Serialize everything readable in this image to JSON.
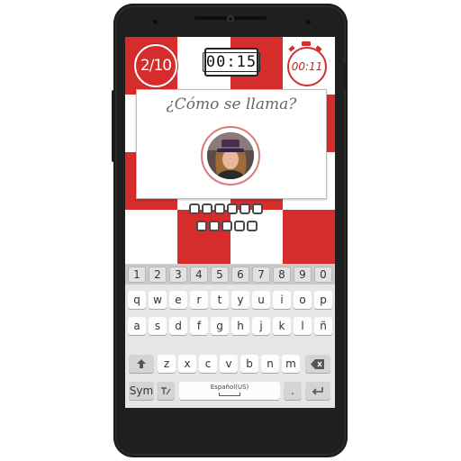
{
  "hud": {
    "score": "2/10",
    "timer": "00:15",
    "stopwatch": "00:11"
  },
  "question": {
    "text": "¿Cómo se llama?",
    "answer_slots": [
      6,
      5
    ]
  },
  "keyboard": {
    "numbers": [
      "1",
      "2",
      "3",
      "4",
      "5",
      "6",
      "7",
      "8",
      "9",
      "0"
    ],
    "row1": [
      "q",
      "w",
      "e",
      "r",
      "t",
      "y",
      "u",
      "i",
      "o",
      "p"
    ],
    "row2": [
      "a",
      "s",
      "d",
      "f",
      "g",
      "h",
      "j",
      "k",
      "l",
      "ñ"
    ],
    "row3": [
      "z",
      "x",
      "c",
      "v",
      "b",
      "n",
      "m"
    ],
    "sym": "Sym",
    "language": "Español(US)",
    "period": "."
  },
  "colors": {
    "accent": "#d62c2c",
    "phone": "#2b2b2b",
    "keyboard_bg": "#e6e6e6"
  },
  "icons": [
    "shift-icon",
    "backspace-icon",
    "handwriting-icon",
    "enter-icon",
    "stopwatch-icon"
  ]
}
